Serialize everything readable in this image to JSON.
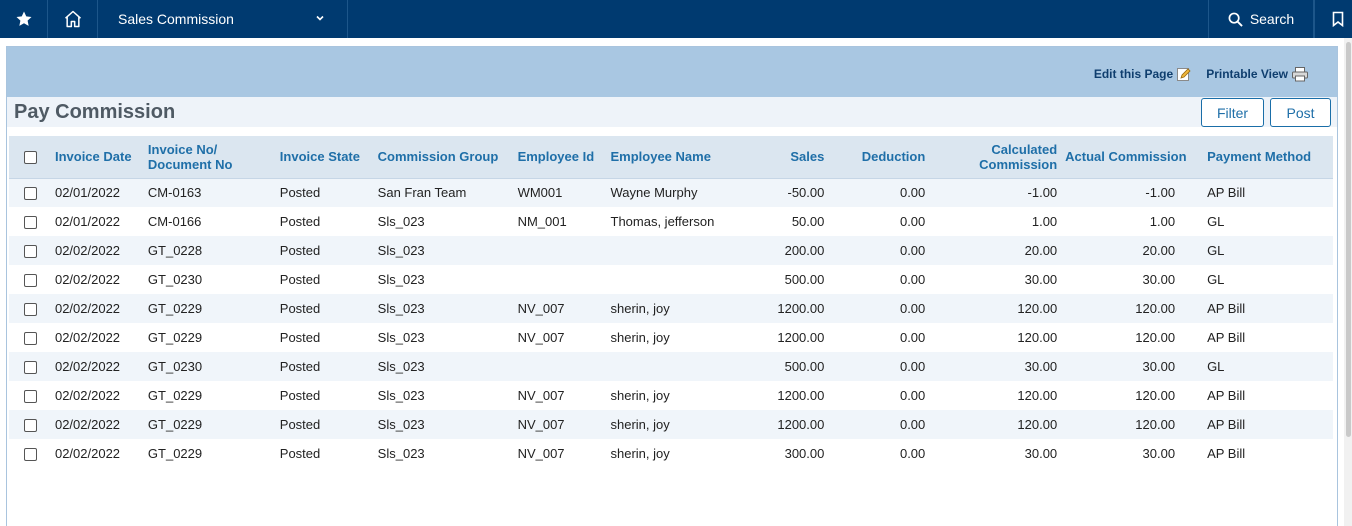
{
  "topbar": {
    "module_label": "Sales Commission",
    "search_label": "Search"
  },
  "toolbar": {
    "edit_label": "Edit this Page",
    "print_label": "Printable View"
  },
  "page": {
    "title": "Pay Commission"
  },
  "buttons": {
    "filter": "Filter",
    "post": "Post"
  },
  "table": {
    "headers": {
      "invoice_date": "Invoice Date",
      "invoice_no_line1": "Invoice No/",
      "invoice_no_line2": "Document No",
      "invoice_state": "Invoice State",
      "commission_group": "Commission Group",
      "employee_id": "Employee Id",
      "employee_name": "Employee Name",
      "sales": "Sales",
      "deduction": "Deduction",
      "calc_line1": "Calculated",
      "calc_line2": "Commission",
      "actual_commission": "Actual Commission",
      "payment_method": "Payment Method"
    },
    "rows": [
      [
        "02/01/2022",
        "CM-0163",
        "Posted",
        "San Fran Team",
        "WM001",
        "Wayne Murphy",
        "-50.00",
        "0.00",
        "-1.00",
        "-1.00",
        "AP Bill"
      ],
      [
        "02/01/2022",
        "CM-0166",
        "Posted",
        "Sls_023",
        "NM_001",
        "Thomas, jefferson",
        "50.00",
        "0.00",
        "1.00",
        "1.00",
        "GL"
      ],
      [
        "02/02/2022",
        "GT_0228",
        "Posted",
        "Sls_023",
        "",
        "",
        "200.00",
        "0.00",
        "20.00",
        "20.00",
        "GL"
      ],
      [
        "02/02/2022",
        "GT_0230",
        "Posted",
        "Sls_023",
        "",
        "",
        "500.00",
        "0.00",
        "30.00",
        "30.00",
        "GL"
      ],
      [
        "02/02/2022",
        "GT_0229",
        "Posted",
        "Sls_023",
        "NV_007",
        "sherin, joy",
        "1200.00",
        "0.00",
        "120.00",
        "120.00",
        "AP Bill"
      ],
      [
        "02/02/2022",
        "GT_0229",
        "Posted",
        "Sls_023",
        "NV_007",
        "sherin, joy",
        "1200.00",
        "0.00",
        "120.00",
        "120.00",
        "AP Bill"
      ],
      [
        "02/02/2022",
        "GT_0230",
        "Posted",
        "Sls_023",
        "",
        "",
        "500.00",
        "0.00",
        "30.00",
        "30.00",
        "GL"
      ],
      [
        "02/02/2022",
        "GT_0229",
        "Posted",
        "Sls_023",
        "NV_007",
        "sherin, joy",
        "1200.00",
        "0.00",
        "120.00",
        "120.00",
        "AP Bill"
      ],
      [
        "02/02/2022",
        "GT_0229",
        "Posted",
        "Sls_023",
        "NV_007",
        "sherin, joy",
        "1200.00",
        "0.00",
        "120.00",
        "120.00",
        "AP Bill"
      ],
      [
        "02/02/2022",
        "GT_0229",
        "Posted",
        "Sls_023",
        "NV_007",
        "sherin, joy",
        "300.00",
        "0.00",
        "30.00",
        "30.00",
        "AP Bill"
      ]
    ]
  },
  "icons": {
    "favorites": "star-icon",
    "home": "home-icon",
    "module_dropdown": "chevron-down-icon",
    "search": "search-icon",
    "bookmark": "bookmark-icon",
    "edit": "edit-page-icon",
    "print": "printer-icon"
  },
  "colors": {
    "nav_bg": "#003a70",
    "panel_head": "#a9c7e2",
    "header_row": "#dbe6f0",
    "link_blue": "#1f6fa8"
  }
}
